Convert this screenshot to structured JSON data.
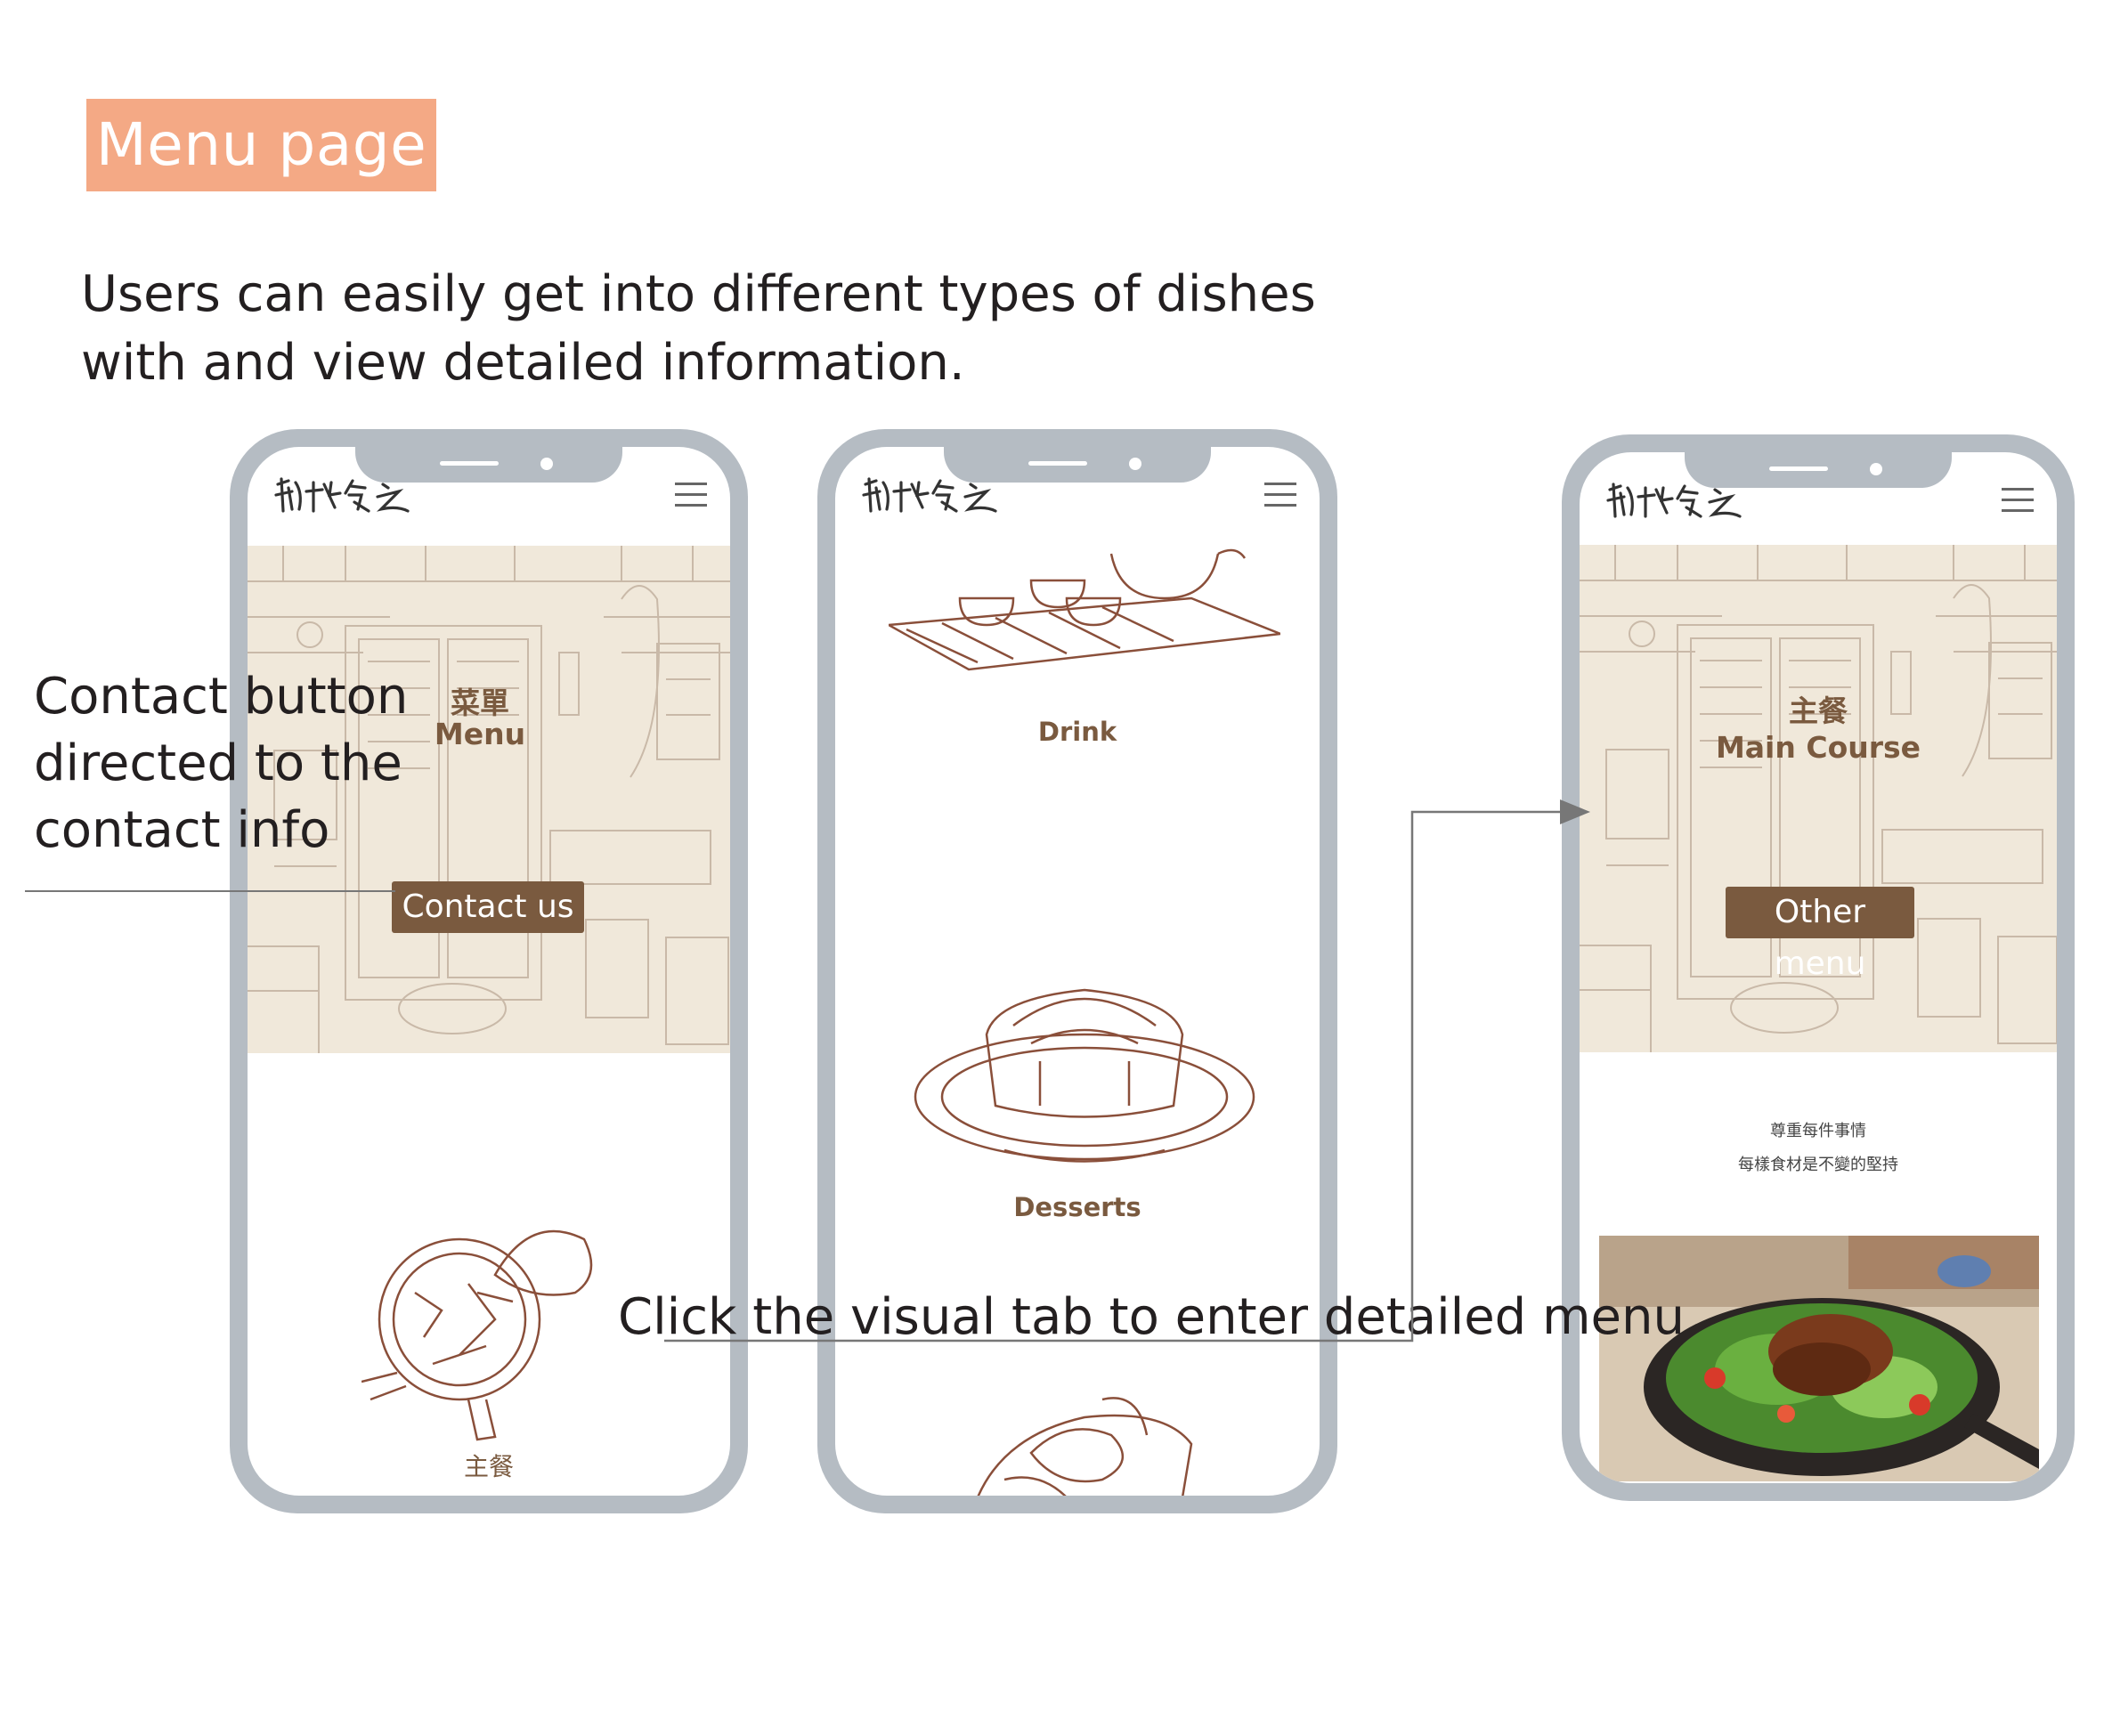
{
  "title": "Menu page",
  "intro": {
    "line1": "Users can easily get into different types of dishes",
    "line2": "with and view detailed information."
  },
  "annotations": {
    "contact_line1": "Contact button",
    "contact_line2": "directed to the",
    "contact_line3": "contact info",
    "visual_tab": "Click the visual tab to enter detailed menu"
  },
  "phone1": {
    "hero_title_zh": "菜單",
    "hero_title_en": "Menu",
    "button": "Contact us",
    "bottom_label": "主餐"
  },
  "phone2": {
    "drink_label": "Drink",
    "desserts_label": "Desserts"
  },
  "phone3": {
    "hero_title_zh": "主餐",
    "hero_title_en": "Main Course",
    "button": "Other menu",
    "tagline1": "尊重每件事情",
    "tagline2": "每樣食材是不變的堅持"
  },
  "icons": {
    "logo": "brand-logo",
    "menu": "hamburger-icon"
  },
  "colors": {
    "accent": "#f4a985",
    "brown": "#7a5a3f",
    "frame": "#b5bcc3"
  }
}
